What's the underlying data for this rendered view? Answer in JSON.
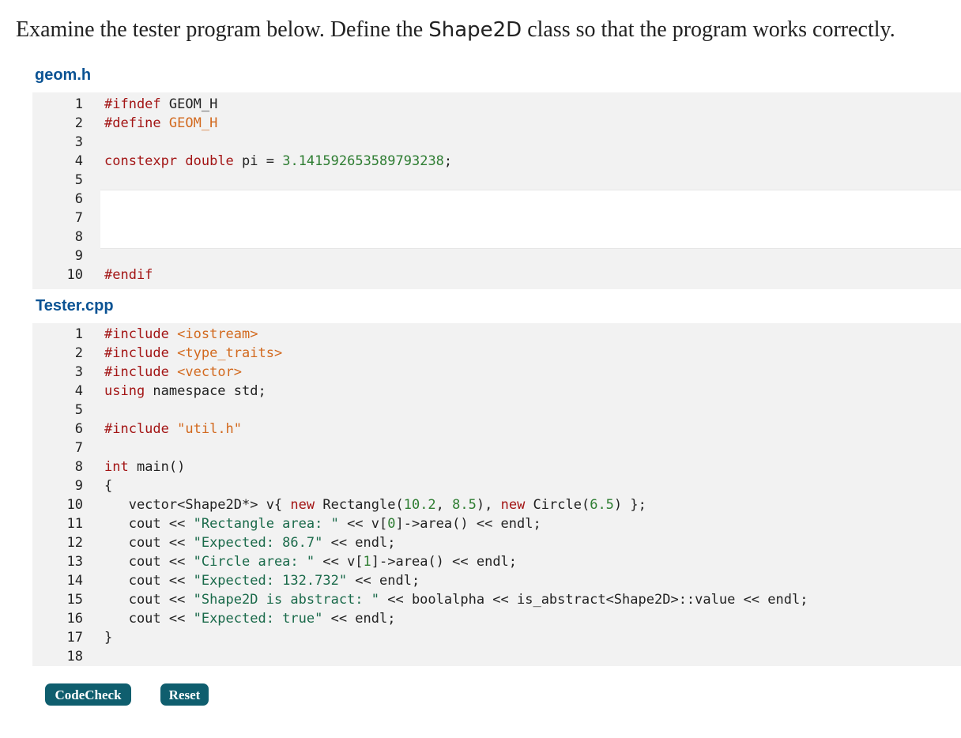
{
  "prompt": {
    "before": "Examine the tester program below. Define the ",
    "class_name": "Shape2D",
    "after": " class so that the program works correctly."
  },
  "geom": {
    "filename": "geom.h",
    "lines": [
      {
        "n": "1",
        "t": "#ifndef GEOM_H"
      },
      {
        "n": "2",
        "t": "#define GEOM_H"
      },
      {
        "n": "3",
        "t": ""
      },
      {
        "n": "4",
        "t": "constexpr double pi = 3.141592653589793238;"
      },
      {
        "n": "5",
        "t": ""
      },
      {
        "n": "6",
        "t": ""
      },
      {
        "n": "7",
        "t": ""
      },
      {
        "n": "8",
        "t": ""
      },
      {
        "n": "9",
        "t": ""
      },
      {
        "n": "10",
        "t": "#endif"
      }
    ]
  },
  "tester": {
    "filename": "Tester.cpp",
    "lines": [
      {
        "n": "1",
        "t": "#include <iostream>"
      },
      {
        "n": "2",
        "t": "#include <type_traits>"
      },
      {
        "n": "3",
        "t": "#include <vector>"
      },
      {
        "n": "4",
        "t": "using namespace std;"
      },
      {
        "n": "5",
        "t": ""
      },
      {
        "n": "6",
        "t": "#include \"util.h\""
      },
      {
        "n": "7",
        "t": ""
      },
      {
        "n": "8",
        "t": "int main()"
      },
      {
        "n": "9",
        "t": "{"
      },
      {
        "n": "10",
        "t": "   vector<Shape2D*> v{ new Rectangle(10.2, 8.5), new Circle(6.5) };"
      },
      {
        "n": "11",
        "t": "   cout << \"Rectangle area: \" << v[0]->area() << endl;"
      },
      {
        "n": "12",
        "t": "   cout << \"Expected: 86.7\" << endl;"
      },
      {
        "n": "13",
        "t": "   cout << \"Circle area: \" << v[1]->area() << endl;"
      },
      {
        "n": "14",
        "t": "   cout << \"Expected: 132.732\" << endl;"
      },
      {
        "n": "15",
        "t": "   cout << \"Shape2D is abstract: \" << boolalpha << is_abstract<Shape2D>::value << endl;"
      },
      {
        "n": "16",
        "t": "   cout << \"Expected: true\" << endl;"
      },
      {
        "n": "17",
        "t": "}"
      },
      {
        "n": "18",
        "t": ""
      }
    ]
  },
  "buttons": {
    "codecheck": "CodeCheck",
    "reset": "Reset"
  },
  "colors": {
    "file_heading": "#0b5394",
    "button_bg": "#0f5e6e",
    "code_bg": "#f2f2f2"
  }
}
